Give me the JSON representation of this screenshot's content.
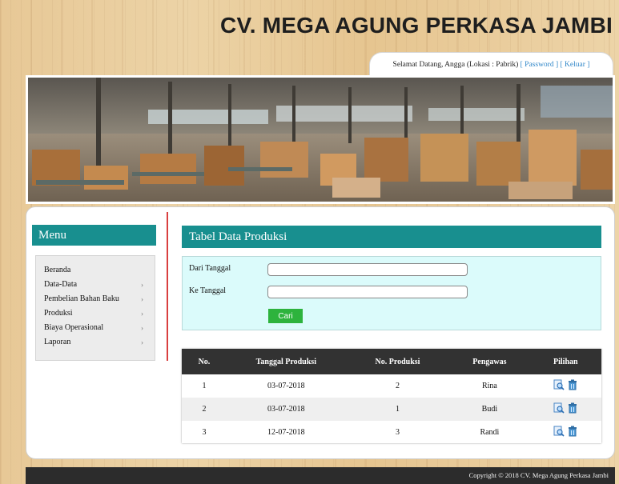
{
  "header": {
    "site_title": "CV. MEGA AGUNG PERKASA JAMBI",
    "welcome_text": "Selamat Datang, Angga (Lokasi : Pabrik)",
    "password_link": "[ Password ]",
    "logout_link": "[ Keluar ]"
  },
  "sidebar": {
    "title": "Menu",
    "items": [
      {
        "label": "Beranda",
        "arrow": ""
      },
      {
        "label": "Data-Data",
        "arrow": "›"
      },
      {
        "label": "Pembelian Bahan Baku",
        "arrow": "›"
      },
      {
        "label": "Produksi",
        "arrow": "›"
      },
      {
        "label": "Biaya Operasional",
        "arrow": "›"
      },
      {
        "label": "Laporan",
        "arrow": "›"
      }
    ]
  },
  "main": {
    "section_title": "Tabel Data Produksi",
    "filter": {
      "from_label": "Dari Tanggal",
      "to_label": "Ke Tanggal",
      "from_value": "",
      "to_value": "",
      "submit_label": "Cari"
    },
    "table": {
      "columns": [
        "No.",
        "Tanggal Produksi",
        "No. Produksi",
        "Pengawas",
        "Pilihan"
      ],
      "rows": [
        {
          "no": "1",
          "tanggal": "03-07-2018",
          "no_produksi": "2",
          "pengawas": "Rina"
        },
        {
          "no": "2",
          "tanggal": "03-07-2018",
          "no_produksi": "1",
          "pengawas": "Budi"
        },
        {
          "no": "3",
          "tanggal": "12-07-2018",
          "no_produksi": "3",
          "pengawas": "Randi"
        }
      ],
      "row_icons": [
        "view-detail-icon",
        "delete-icon"
      ]
    }
  },
  "footer": {
    "copyright": "Copyright © 2018 CV. Mega Agung Perkasa Jambi"
  },
  "colors": {
    "accent_teal": "#188f8f",
    "divider_red": "#d94040",
    "button_green": "#2db33d",
    "header_dark": "#323232",
    "link_blue": "#2f86c8"
  }
}
